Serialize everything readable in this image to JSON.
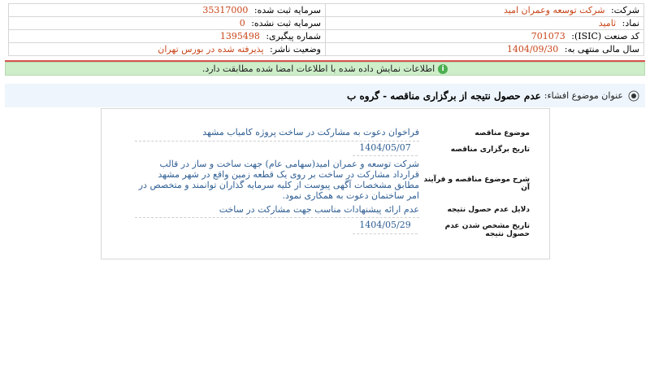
{
  "header": {
    "company_label": "شرکت:",
    "company_value": "شرکت توسعه وعمران امید",
    "registered_capital_label": "سرمایه ثبت شده:",
    "registered_capital_value": "35317000",
    "symbol_label": "نماد:",
    "symbol_value": "ثامید",
    "unregistered_capital_label": "سرمایه ثبت نشده:",
    "unregistered_capital_value": "0",
    "isic_label": "کد صنعت (ISIC):",
    "isic_value": "701073",
    "tracking_label": "شماره پیگیری:",
    "tracking_value": "1395498",
    "fiscal_year_label": "سال مالی منتهی به:",
    "fiscal_year_value": "1404/09/30",
    "publisher_status_label": "وضعیت ناشر:",
    "publisher_status_value": "پذیرفته شده در بورس تهران"
  },
  "banner": {
    "icon": "info-icon",
    "text": "اطلاعات نمایش داده شده با اطلاعات امضا شده مطابقت دارد."
  },
  "subject": {
    "label": "عنوان موضوع افشاء:",
    "title": "عدم حصول نتیجه از برگزاری مناقصه - گروه ب"
  },
  "details": [
    {
      "key": "موضوع مناقصه",
      "value": "فراخوان دعوت به مشارکت در ساخت پروژه کامیاب مشهد"
    },
    {
      "key": "تاریخ برگزاری مناقصه",
      "value": "1404/05/07"
    },
    {
      "key": "شرح موضوع مناقصه و فرآیند آن",
      "value": "شرکت توسعه و عمران امید(سهامی عام) جهت ساخت و ساز در قالب قرارداد مشارکت در ساخت بر روی یک قطعه زمین واقع در شهر مشهد مطابق مشخصات آگهی پیوست از کلیه سرمایه گذاران توانمند و متخصص در امر ساختمان دعوت به همکاری نمود."
    },
    {
      "key": "دلایل عدم حصول نتیجه",
      "value": "عدم ارائه پیشنهادات مناسب جهت مشارکت در ساخت"
    },
    {
      "key": "تاریخ مشخص شدن عدم حصول نتیجه",
      "value": "1404/05/29"
    }
  ],
  "colors": {
    "value_orange": "#c8461a",
    "value_blue": "#2f5e93",
    "banner_green": "#cdeec9",
    "red_line": "#d9534f"
  }
}
